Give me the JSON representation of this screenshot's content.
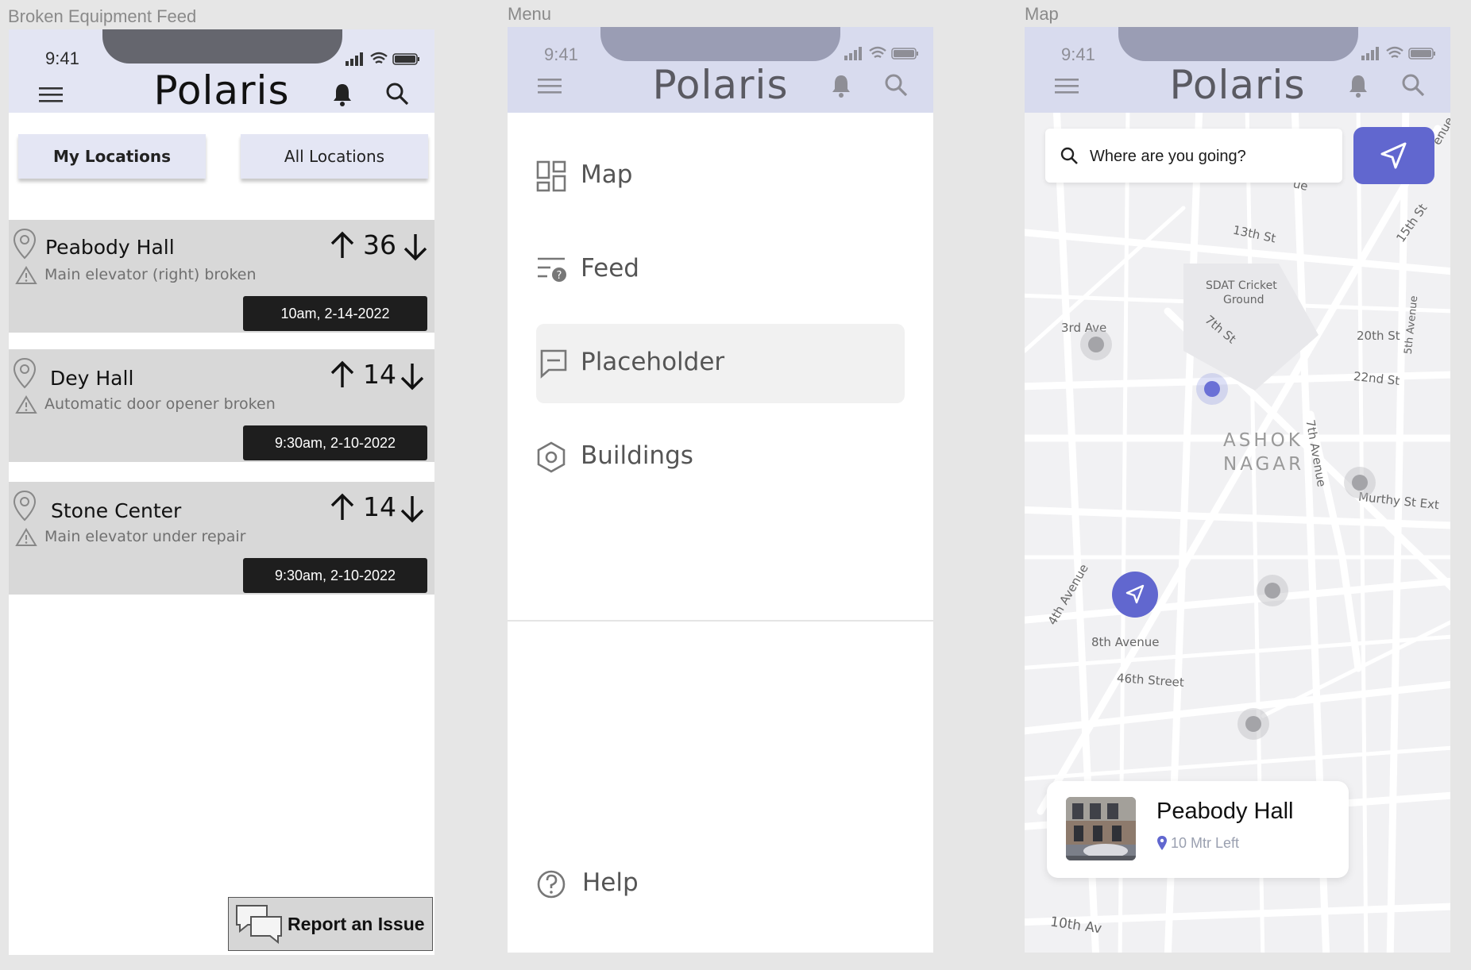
{
  "frames": {
    "feed_title": "Broken Equipment Feed",
    "menu_title": "Menu",
    "map_title": "Map"
  },
  "status_time": "9:41",
  "brand": "Polaris",
  "feed": {
    "tab_my": "My Locations",
    "tab_all": "All Locations",
    "cards": [
      {
        "location": "Peabody Hall",
        "issue": "Main elevator (right) broken",
        "votes": "36",
        "timestamp": "10am, 2-14-2022"
      },
      {
        "location": "Dey Hall",
        "issue": "Automatic door opener broken",
        "votes": "14",
        "timestamp": "9:30am, 2-10-2022"
      },
      {
        "location": "Stone Center",
        "issue": "Main elevator under repair",
        "votes": "14",
        "timestamp": "9:30am, 2-10-2022"
      }
    ],
    "report_label": "Report an Issue"
  },
  "menu": {
    "items": [
      {
        "label": "Map",
        "icon": "dashboard-grid-icon"
      },
      {
        "label": "Feed",
        "icon": "feed-list-icon"
      },
      {
        "label": "Placeholder",
        "icon": "message-square-icon"
      },
      {
        "label": "Buildings",
        "icon": "hexagon-icon"
      }
    ],
    "help_label": "Help"
  },
  "map": {
    "search_placeholder": "Where are you going?",
    "labels": {
      "third_ave": "3rd Ave",
      "thirteenth_st": "13th St",
      "fifteenth_st": "15th St",
      "sdat_line1": "SDAT Cricket",
      "sdat_line2": "Ground",
      "seventh_st": "7th St",
      "twentieth_st": "20th St",
      "twentysecond_st": "22nd St",
      "fifth_avenue": "5th Avenue",
      "seventh_avenue": "7th Avenue",
      "ashok": "ASHOK",
      "nagar": "NAGAR",
      "murthy": "Murthy St Ext",
      "fourth_avenue": "4th Avenue",
      "eighth_avenue": "8th Avenue",
      "fortysixth_street": "46th Street",
      "tenth_av": "10th Av",
      "ue_top": "ue",
      "enue_edge": "enue"
    },
    "card": {
      "title": "Peabody Hall",
      "distance": "10 Mtr Left"
    }
  },
  "colors": {
    "accent": "#6167cf",
    "header": "#e3e5f3",
    "card_bg": "#d8d8d8",
    "stamp": "#1e1e1e"
  }
}
